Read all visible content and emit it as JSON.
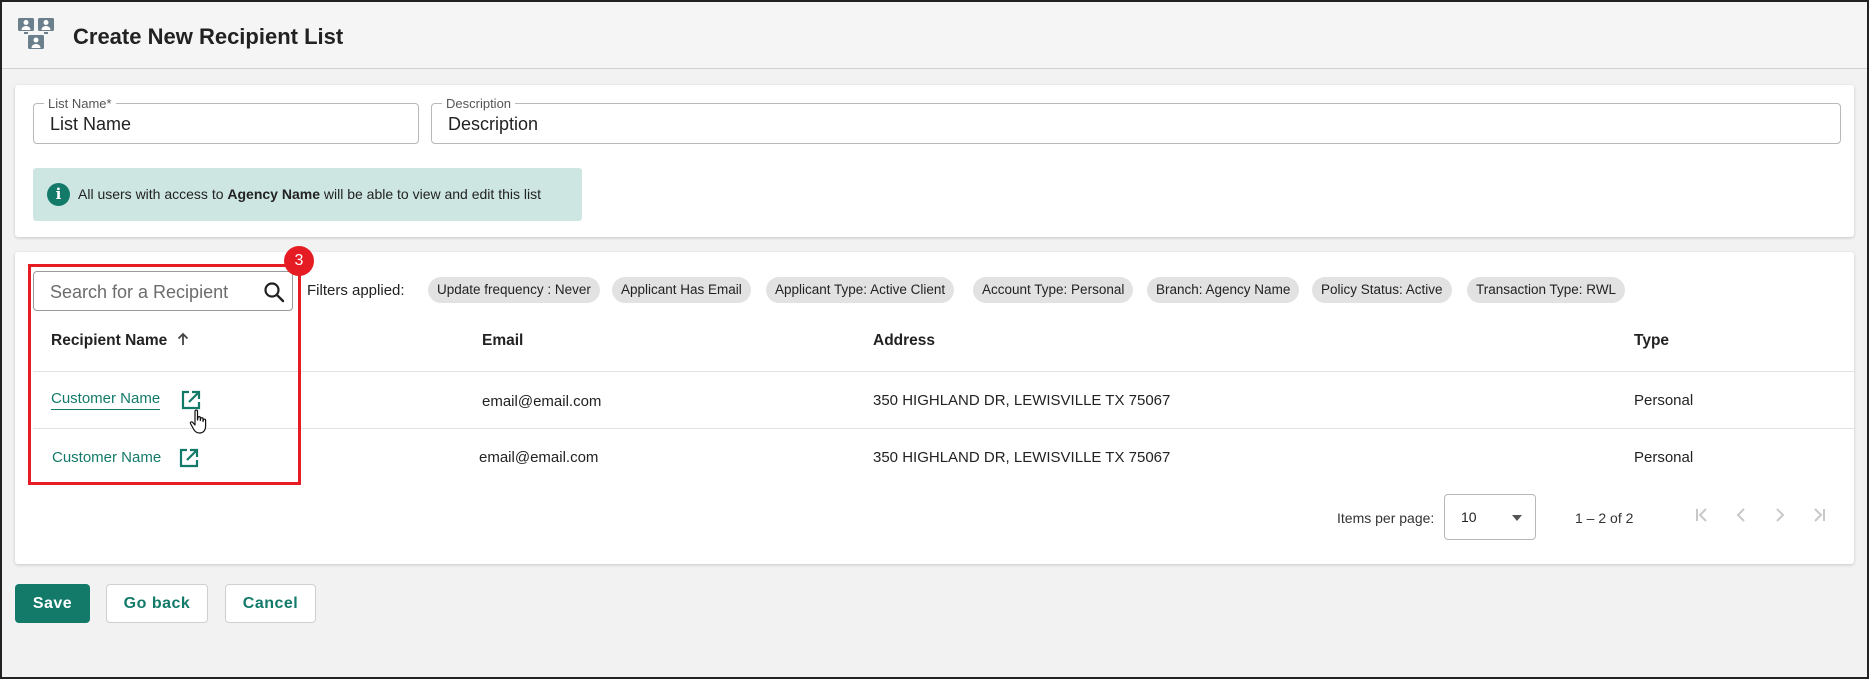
{
  "header": {
    "title": "Create New Recipient List"
  },
  "form": {
    "list_name": {
      "label": "List Name*",
      "value": "List Name"
    },
    "description": {
      "label": "Description",
      "value": "Description"
    }
  },
  "info": {
    "prefix": "All users with access to ",
    "agency": "Agency Name",
    "suffix": " will be able to view and edit this list"
  },
  "search": {
    "placeholder": "Search for a Recipient"
  },
  "filters": {
    "label": "Filters applied:",
    "chips": [
      "Update frequency : Never",
      "Applicant Has Email",
      "Applicant Type: Active Client",
      "Account Type: Personal",
      "Branch: Agency Name",
      "Policy Status: Active",
      "Transaction Type: RWL"
    ]
  },
  "table": {
    "columns": [
      "Recipient Name",
      "Email",
      "Address",
      "Type"
    ],
    "rows": [
      {
        "name": "Customer Name",
        "email": "email@email.com",
        "address": "350 HIGHLAND DR, LEWISVILLE TX 75067",
        "type": "Personal"
      },
      {
        "name": "Customer Name",
        "email": "email@email.com",
        "address": "350 HIGHLAND DR, LEWISVILLE TX 75067",
        "type": "Personal"
      }
    ]
  },
  "pagination": {
    "items_per_page_label": "Items per page:",
    "items_per_page": "10",
    "range": "1 – 2 of 2"
  },
  "annotation": {
    "badge": "3"
  },
  "actions": {
    "save": "Save",
    "back": "Go back",
    "cancel": "Cancel"
  },
  "colors": {
    "accent": "#137a6a",
    "highlight": "#e51c23",
    "info_bg": "#cde6e2"
  }
}
